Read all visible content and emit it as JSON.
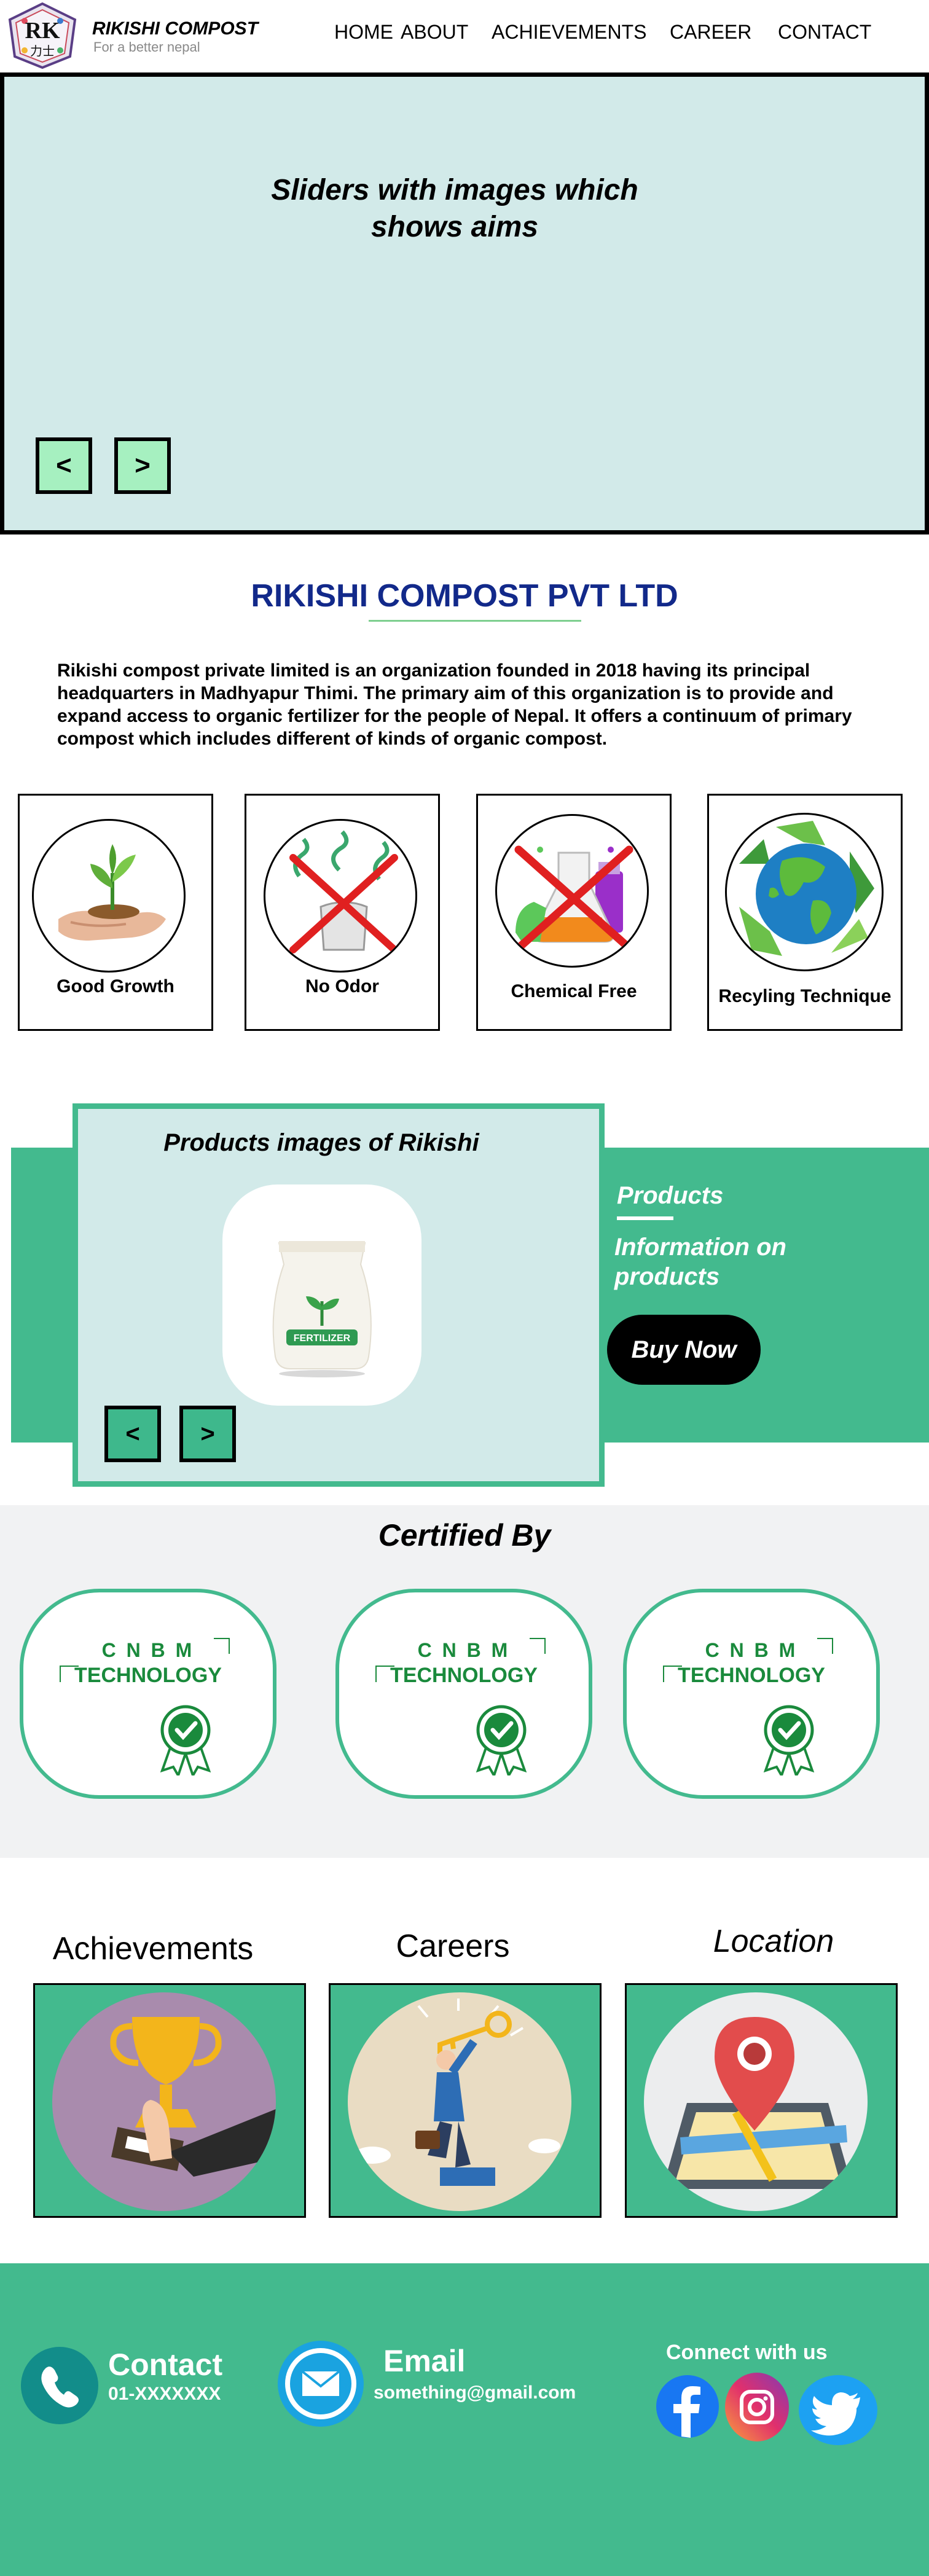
{
  "nav": {
    "logo_text": "RK",
    "brand": "RIKISHI COMPOST",
    "tagline": "For a better nepal",
    "links": [
      "HOME",
      "ABOUT",
      "ACHIEVEMENTS",
      "CAREER",
      "CONTACT"
    ]
  },
  "hero": {
    "text": "Sliders with images which shows aims",
    "prev": "<",
    "next": ">"
  },
  "about": {
    "company": "RIKISHI COMPOST PVT LTD",
    "paragraph": "Rikishi compost private limited is an organization founded in 2018 having its principal headquarters in Madhyapur Thimi. The primary aim of this organization is to provide and expand access to organic fertilizer for the people of Nepal. It offers a continuum of primary compost which includes different of kinds of organic compost."
  },
  "features": [
    {
      "label": "Good Growth",
      "icon": "plant-in-hand-icon"
    },
    {
      "label": "No Odor",
      "icon": "no-odor-icon"
    },
    {
      "label": "Chemical Free",
      "icon": "chemical-free-icon"
    },
    {
      "label": "Recyling Technique",
      "icon": "recycle-globe-icon"
    }
  ],
  "products": {
    "title": "Products images of Rikishi",
    "bag_label": "FERTILIZER",
    "prev": "<",
    "next": ">",
    "label": "Products",
    "info": "Information on products",
    "buy": "Buy Now"
  },
  "certified": {
    "title": "Certified By",
    "cards": [
      {
        "line1": "C N B M",
        "line2": "TECHNOLOGY"
      },
      {
        "line1": "C N B M",
        "line2": "TECHNOLOGY"
      },
      {
        "line1": "C N B M",
        "line2": "TECHNOLOGY"
      }
    ]
  },
  "sections": {
    "achievements": "Achievements",
    "careers": "Careers",
    "location": "Location"
  },
  "footer": {
    "contact_label": "Contact",
    "contact_value": "01-XXXXXXX",
    "email_label": "Email",
    "email_value": "something@gmail.com",
    "connect": "Connect with us"
  },
  "colors": {
    "green": "#43ba8e",
    "hero_bg": "#d2eae9",
    "company_blue": "#12298a",
    "cert_green": "#1a8a3c"
  }
}
